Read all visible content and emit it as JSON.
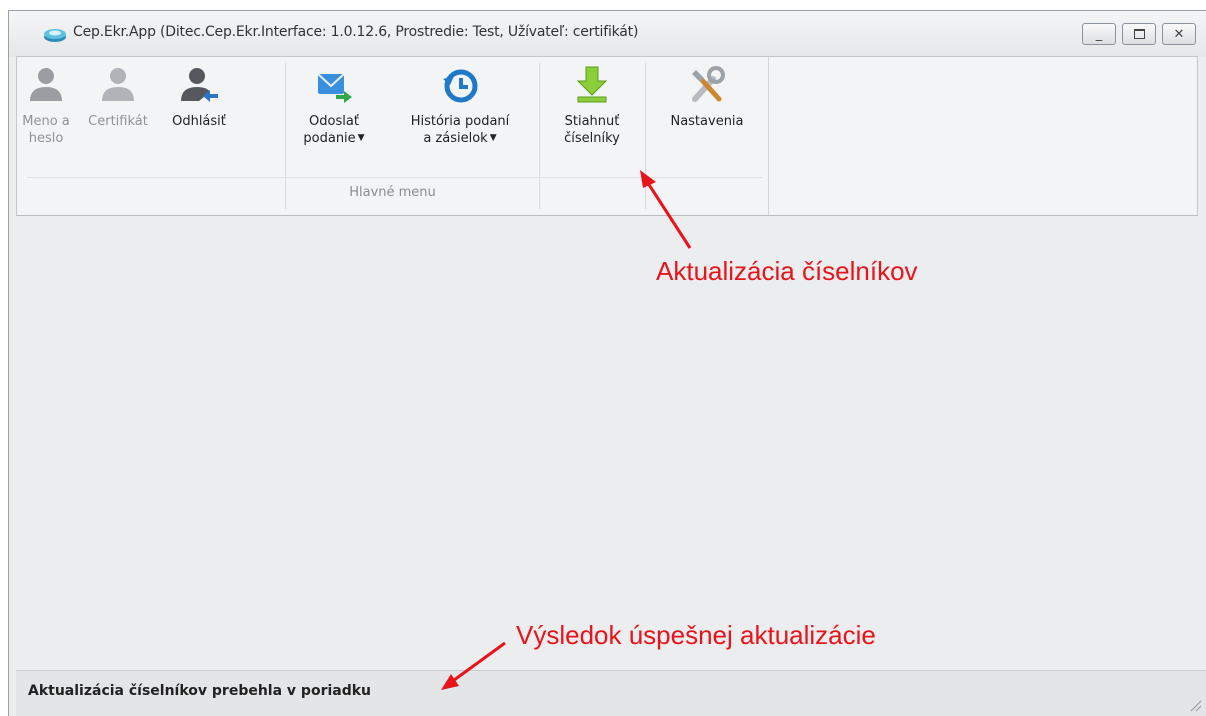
{
  "window": {
    "title": "Cep.Ekr.App (Ditec.Cep.Ekr.Interface: 1.0.12.6, Prostredie: Test, Užívateľ: certifikát)"
  },
  "ribbon": {
    "group_label": "Hlavné menu",
    "buttons": [
      {
        "line1": "Meno a",
        "line2": "heslo",
        "icon": "user-icon",
        "enabled": false
      },
      {
        "line1": "Certifikát",
        "line2": "",
        "icon": "user-icon",
        "enabled": false
      },
      {
        "line1": "Odhlásiť",
        "line2": "",
        "icon": "logout-user-icon",
        "enabled": true
      },
      {
        "line1": "Odoslať",
        "line2": "podanie",
        "icon": "send-mail-icon",
        "enabled": true,
        "dropdown": true
      },
      {
        "line1": "História podaní",
        "line2": "a zásielok",
        "icon": "history-icon",
        "enabled": true,
        "dropdown": true
      },
      {
        "line1": "Stiahnuť",
        "line2": "číselníky",
        "icon": "download-icon",
        "enabled": true
      },
      {
        "line1": "Nastavenia",
        "line2": "",
        "icon": "tools-icon",
        "enabled": true
      }
    ]
  },
  "status": {
    "text": "Aktualizácia číselníkov prebehla v poriadku"
  },
  "annotations": {
    "top": "Aktualizácia číselníkov",
    "bottom": "Výsledok úspešnej aktualizácie",
    "color": "#e8141b"
  }
}
